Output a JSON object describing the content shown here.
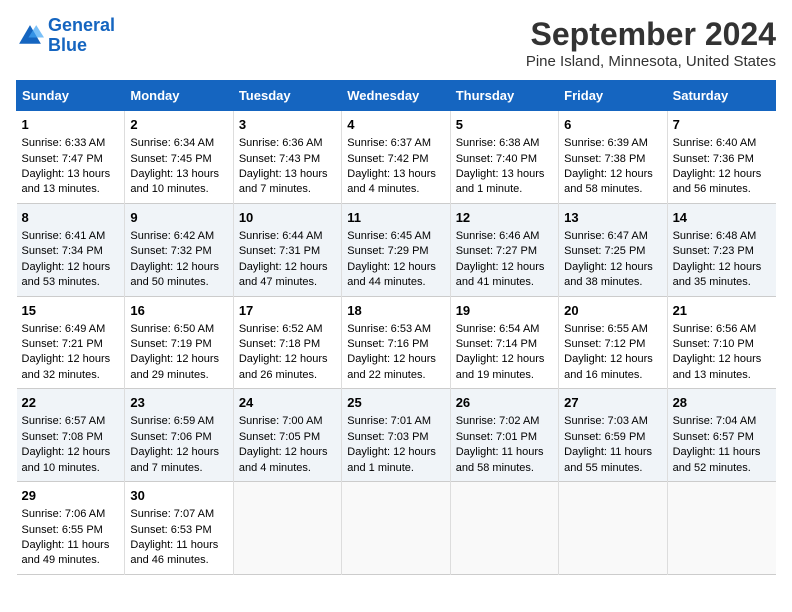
{
  "logo": {
    "line1": "General",
    "line2": "Blue"
  },
  "title": "September 2024",
  "subtitle": "Pine Island, Minnesota, United States",
  "days_of_week": [
    "Sunday",
    "Monday",
    "Tuesday",
    "Wednesday",
    "Thursday",
    "Friday",
    "Saturday"
  ],
  "weeks": [
    [
      {
        "day": "1",
        "sunrise": "6:33 AM",
        "sunset": "7:47 PM",
        "daylight": "Daylight: 13 hours and 13 minutes."
      },
      {
        "day": "2",
        "sunrise": "6:34 AM",
        "sunset": "7:45 PM",
        "daylight": "Daylight: 13 hours and 10 minutes."
      },
      {
        "day": "3",
        "sunrise": "6:36 AM",
        "sunset": "7:43 PM",
        "daylight": "Daylight: 13 hours and 7 minutes."
      },
      {
        "day": "4",
        "sunrise": "6:37 AM",
        "sunset": "7:42 PM",
        "daylight": "Daylight: 13 hours and 4 minutes."
      },
      {
        "day": "5",
        "sunrise": "6:38 AM",
        "sunset": "7:40 PM",
        "daylight": "Daylight: 13 hours and 1 minute."
      },
      {
        "day": "6",
        "sunrise": "6:39 AM",
        "sunset": "7:38 PM",
        "daylight": "Daylight: 12 hours and 58 minutes."
      },
      {
        "day": "7",
        "sunrise": "6:40 AM",
        "sunset": "7:36 PM",
        "daylight": "Daylight: 12 hours and 56 minutes."
      }
    ],
    [
      {
        "day": "8",
        "sunrise": "6:41 AM",
        "sunset": "7:34 PM",
        "daylight": "Daylight: 12 hours and 53 minutes."
      },
      {
        "day": "9",
        "sunrise": "6:42 AM",
        "sunset": "7:32 PM",
        "daylight": "Daylight: 12 hours and 50 minutes."
      },
      {
        "day": "10",
        "sunrise": "6:44 AM",
        "sunset": "7:31 PM",
        "daylight": "Daylight: 12 hours and 47 minutes."
      },
      {
        "day": "11",
        "sunrise": "6:45 AM",
        "sunset": "7:29 PM",
        "daylight": "Daylight: 12 hours and 44 minutes."
      },
      {
        "day": "12",
        "sunrise": "6:46 AM",
        "sunset": "7:27 PM",
        "daylight": "Daylight: 12 hours and 41 minutes."
      },
      {
        "day": "13",
        "sunrise": "6:47 AM",
        "sunset": "7:25 PM",
        "daylight": "Daylight: 12 hours and 38 minutes."
      },
      {
        "day": "14",
        "sunrise": "6:48 AM",
        "sunset": "7:23 PM",
        "daylight": "Daylight: 12 hours and 35 minutes."
      }
    ],
    [
      {
        "day": "15",
        "sunrise": "6:49 AM",
        "sunset": "7:21 PM",
        "daylight": "Daylight: 12 hours and 32 minutes."
      },
      {
        "day": "16",
        "sunrise": "6:50 AM",
        "sunset": "7:19 PM",
        "daylight": "Daylight: 12 hours and 29 minutes."
      },
      {
        "day": "17",
        "sunrise": "6:52 AM",
        "sunset": "7:18 PM",
        "daylight": "Daylight: 12 hours and 26 minutes."
      },
      {
        "day": "18",
        "sunrise": "6:53 AM",
        "sunset": "7:16 PM",
        "daylight": "Daylight: 12 hours and 22 minutes."
      },
      {
        "day": "19",
        "sunrise": "6:54 AM",
        "sunset": "7:14 PM",
        "daylight": "Daylight: 12 hours and 19 minutes."
      },
      {
        "day": "20",
        "sunrise": "6:55 AM",
        "sunset": "7:12 PM",
        "daylight": "Daylight: 12 hours and 16 minutes."
      },
      {
        "day": "21",
        "sunrise": "6:56 AM",
        "sunset": "7:10 PM",
        "daylight": "Daylight: 12 hours and 13 minutes."
      }
    ],
    [
      {
        "day": "22",
        "sunrise": "6:57 AM",
        "sunset": "7:08 PM",
        "daylight": "Daylight: 12 hours and 10 minutes."
      },
      {
        "day": "23",
        "sunrise": "6:59 AM",
        "sunset": "7:06 PM",
        "daylight": "Daylight: 12 hours and 7 minutes."
      },
      {
        "day": "24",
        "sunrise": "7:00 AM",
        "sunset": "7:05 PM",
        "daylight": "Daylight: 12 hours and 4 minutes."
      },
      {
        "day": "25",
        "sunrise": "7:01 AM",
        "sunset": "7:03 PM",
        "daylight": "Daylight: 12 hours and 1 minute."
      },
      {
        "day": "26",
        "sunrise": "7:02 AM",
        "sunset": "7:01 PM",
        "daylight": "Daylight: 11 hours and 58 minutes."
      },
      {
        "day": "27",
        "sunrise": "7:03 AM",
        "sunset": "6:59 PM",
        "daylight": "Daylight: 11 hours and 55 minutes."
      },
      {
        "day": "28",
        "sunrise": "7:04 AM",
        "sunset": "6:57 PM",
        "daylight": "Daylight: 11 hours and 52 minutes."
      }
    ],
    [
      {
        "day": "29",
        "sunrise": "7:06 AM",
        "sunset": "6:55 PM",
        "daylight": "Daylight: 11 hours and 49 minutes."
      },
      {
        "day": "30",
        "sunrise": "7:07 AM",
        "sunset": "6:53 PM",
        "daylight": "Daylight: 11 hours and 46 minutes."
      },
      null,
      null,
      null,
      null,
      null
    ]
  ],
  "labels": {
    "sunrise_prefix": "Sunrise: ",
    "sunset_prefix": "Sunset: ",
    "daylight_prefix": ""
  }
}
